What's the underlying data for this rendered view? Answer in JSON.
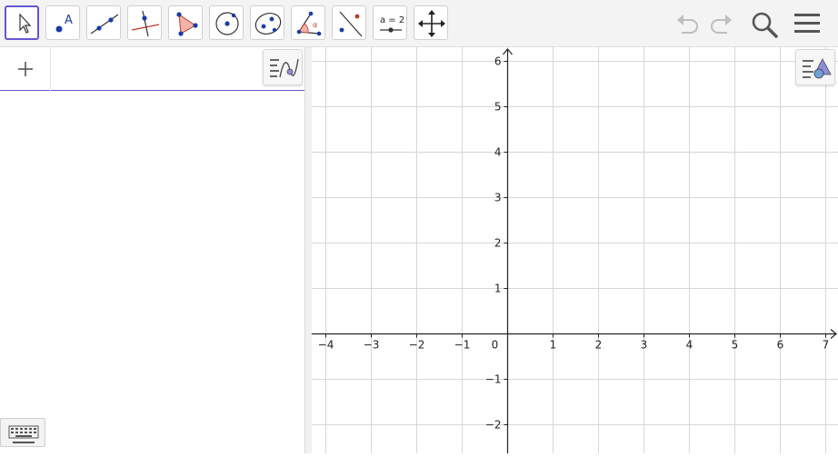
{
  "toolbar": {
    "tools": [
      {
        "name": "move-tool"
      },
      {
        "name": "point-tool",
        "label": "A"
      },
      {
        "name": "line-tool"
      },
      {
        "name": "perpendicular-line-tool"
      },
      {
        "name": "polygon-tool"
      },
      {
        "name": "circle-center-point-tool"
      },
      {
        "name": "conic-tool"
      },
      {
        "name": "angle-tool"
      },
      {
        "name": "reflect-tool"
      },
      {
        "name": "slider-tool",
        "label": "a = 2"
      },
      {
        "name": "move-graphics-view-tool"
      }
    ],
    "right_icons": [
      "undo-icon",
      "redo-icon",
      "search-icon",
      "menu-icon"
    ]
  },
  "algebra": {
    "add_icon": "plus-icon",
    "style_icon": "algebra-style-icon"
  },
  "graphics": {
    "style_icon": "graphics-style-icon",
    "x_ticks": [
      "−4",
      "−3",
      "−2",
      "−1",
      "0",
      "1",
      "2",
      "3",
      "4",
      "5",
      "6",
      "7"
    ],
    "y_ticks": [
      "6",
      "5",
      "4",
      "3",
      "2",
      "1",
      "−1",
      "−2"
    ]
  },
  "keyboard": {
    "icon": "keyboard-icon"
  },
  "colors": {
    "accent": "#6557d2",
    "point": "#1a3ba8",
    "polygon_fill": "#f4b2a8"
  }
}
